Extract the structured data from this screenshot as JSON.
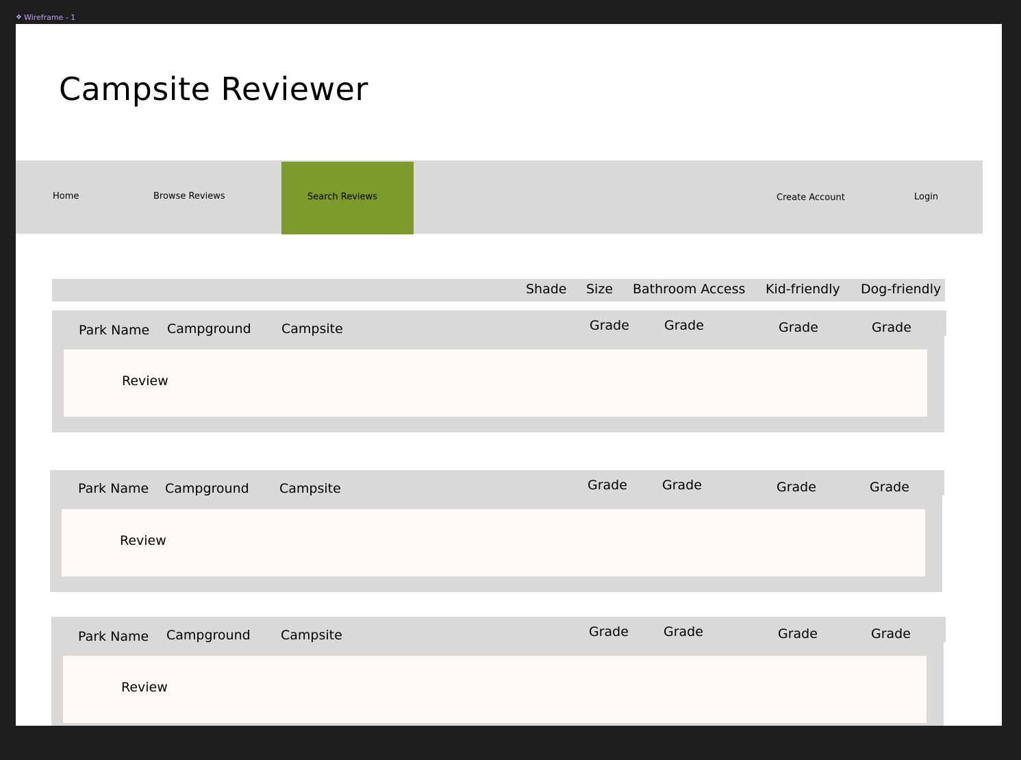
{
  "frame": {
    "label": "Wireframe - 1",
    "icon": "frame-icon"
  },
  "page": {
    "title": "Campsite Reviewer"
  },
  "nav": {
    "home": "Home",
    "browse": "Browse Reviews",
    "search": "Search Reviews",
    "create_account": "Create Account",
    "login": "Login",
    "active_color": "#7f9a2c"
  },
  "filters": {
    "shade": "Shade",
    "size": "Size",
    "bathroom": "Bathroom Access",
    "kid": "Kid-friendly",
    "dog": "Dog-friendly"
  },
  "reviews": [
    {
      "park": "Park Name",
      "campground": "Campground",
      "campsite": "Campsite",
      "grades": [
        "Grade",
        "Grade",
        "Grade",
        "Grade"
      ],
      "review": "Review"
    },
    {
      "park": "Park Name",
      "campground": "Campground",
      "campsite": "Campsite",
      "grades": [
        "Grade",
        "Grade",
        "Grade",
        "Grade"
      ],
      "review": "Review"
    },
    {
      "park": "Park Name",
      "campground": "Campground",
      "campsite": "Campsite",
      "grades": [
        "Grade",
        "Grade",
        "Grade",
        "Grade"
      ],
      "review": "Review"
    }
  ]
}
